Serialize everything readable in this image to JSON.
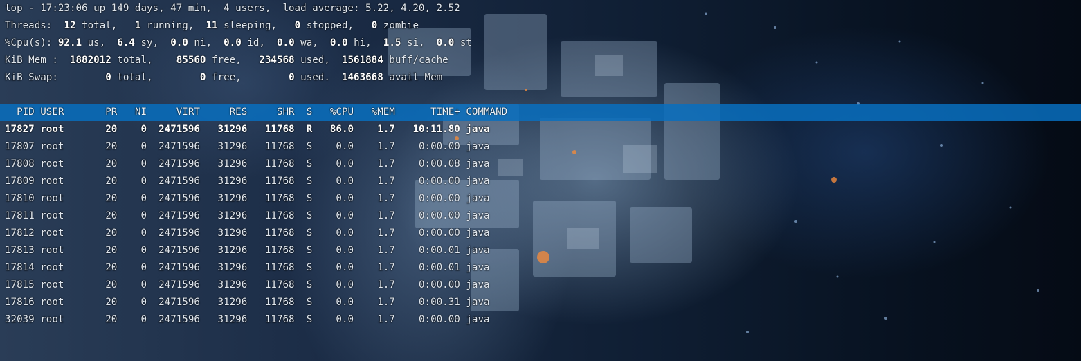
{
  "summary": {
    "uptime_line": "top - 17:23:06 up 149 days, 47 min,  4 users,  load average: 5.22, 4.20, 2.52",
    "threads": {
      "label": "Threads:",
      "total": "12",
      "total_label": "total,",
      "running": "1",
      "running_label": "running,",
      "sleeping": "11",
      "sleeping_label": "sleeping,",
      "stopped": "0",
      "stopped_label": "stopped,",
      "zombie": "0",
      "zombie_label": "zombie"
    },
    "cpu": {
      "label": "%Cpu(s):",
      "us": "92.1",
      "us_label": "us,",
      "sy": "6.4",
      "sy_label": "sy,",
      "ni": "0.0",
      "ni_label": "ni,",
      "id": "0.0",
      "id_label": "id,",
      "wa": "0.0",
      "wa_label": "wa,",
      "hi": "0.0",
      "hi_label": "hi,",
      "si": "1.5",
      "si_label": "si,",
      "st": "0.0",
      "st_label": "st"
    },
    "mem": {
      "label": "KiB Mem :",
      "total": "1882012",
      "total_label": "total,",
      "free": "85560",
      "free_label": "free,",
      "used": "234568",
      "used_label": "used,",
      "buff": "1561884",
      "buff_label": "buff/cache"
    },
    "swap": {
      "label": "KiB Swap:",
      "total": "0",
      "total_label": "total,",
      "free": "0",
      "free_label": "free,",
      "used": "0",
      "used_label": "used.",
      "avail": "1463668",
      "avail_label": "avail Mem"
    }
  },
  "table": {
    "header": [
      "PID",
      "USER",
      "PR",
      "NI",
      "VIRT",
      "RES",
      "SHR",
      "S",
      "%CPU",
      "%MEM",
      "TIME+",
      "COMMAND"
    ],
    "rows": [
      [
        "17827",
        "root",
        "20",
        "0",
        "2471596",
        "31296",
        "11768",
        "R",
        "86.0",
        "1.7",
        "10:11.80",
        "java"
      ],
      [
        "17807",
        "root",
        "20",
        "0",
        "2471596",
        "31296",
        "11768",
        "S",
        "0.0",
        "1.7",
        "0:00.00",
        "java"
      ],
      [
        "17808",
        "root",
        "20",
        "0",
        "2471596",
        "31296",
        "11768",
        "S",
        "0.0",
        "1.7",
        "0:00.08",
        "java"
      ],
      [
        "17809",
        "root",
        "20",
        "0",
        "2471596",
        "31296",
        "11768",
        "S",
        "0.0",
        "1.7",
        "0:00.00",
        "java"
      ],
      [
        "17810",
        "root",
        "20",
        "0",
        "2471596",
        "31296",
        "11768",
        "S",
        "0.0",
        "1.7",
        "0:00.00",
        "java"
      ],
      [
        "17811",
        "root",
        "20",
        "0",
        "2471596",
        "31296",
        "11768",
        "S",
        "0.0",
        "1.7",
        "0:00.00",
        "java"
      ],
      [
        "17812",
        "root",
        "20",
        "0",
        "2471596",
        "31296",
        "11768",
        "S",
        "0.0",
        "1.7",
        "0:00.00",
        "java"
      ],
      [
        "17813",
        "root",
        "20",
        "0",
        "2471596",
        "31296",
        "11768",
        "S",
        "0.0",
        "1.7",
        "0:00.01",
        "java"
      ],
      [
        "17814",
        "root",
        "20",
        "0",
        "2471596",
        "31296",
        "11768",
        "S",
        "0.0",
        "1.7",
        "0:00.01",
        "java"
      ],
      [
        "17815",
        "root",
        "20",
        "0",
        "2471596",
        "31296",
        "11768",
        "S",
        "0.0",
        "1.7",
        "0:00.00",
        "java"
      ],
      [
        "17816",
        "root",
        "20",
        "0",
        "2471596",
        "31296",
        "11768",
        "S",
        "0.0",
        "1.7",
        "0:00.31",
        "java"
      ],
      [
        "32039",
        "root",
        "20",
        "0",
        "2471596",
        "31296",
        "11768",
        "S",
        "0.0",
        "1.7",
        "0:00.00",
        "java"
      ]
    ]
  },
  "colors": {
    "header_bar": "#086ebe",
    "text": "#dfe6ee",
    "highlight_text": "#ffffff"
  }
}
